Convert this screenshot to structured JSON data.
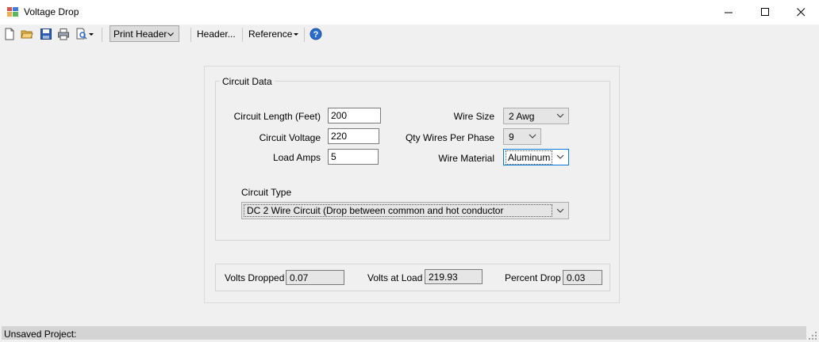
{
  "window": {
    "title": "Voltage Drop",
    "minimize_glyph": "—",
    "maximize_glyph": "☐",
    "close_glyph": "✕"
  },
  "toolbar": {
    "icons": [
      "new-document-icon",
      "open-folder-icon",
      "save-icon",
      "print-icon",
      "print-preview-icon"
    ],
    "print_header_label": "Print Header",
    "header_label": "Header...",
    "reference_label": "Reference",
    "help_icon": "help-icon"
  },
  "circuit_data": {
    "group_title": "Circuit Data",
    "circuit_length_label": "Circuit Length (Feet)",
    "circuit_length_value": "200",
    "circuit_voltage_label": "Circuit Voltage",
    "circuit_voltage_value": "220",
    "load_amps_label": "Load Amps",
    "load_amps_value": "5",
    "wire_size_label": "Wire Size",
    "wire_size_value": "2 Awg",
    "qty_wires_label": "Qty Wires Per Phase",
    "qty_wires_value": "9",
    "wire_material_label": "Wire Material",
    "wire_material_value": "Aluminum",
    "circuit_type_label": "Circuit Type",
    "circuit_type_value": "DC 2 Wire Circuit (Drop between common and hot conductor"
  },
  "results": {
    "volts_dropped_label": "Volts Dropped",
    "volts_dropped_value": "0.07",
    "volts_at_load_label": "Volts at Load",
    "volts_at_load_value": "219.93",
    "percent_drop_label": "Percent Drop",
    "percent_drop_value": "0.03"
  },
  "status": {
    "text": "Unsaved Project:"
  },
  "colors": {
    "focus_border": "#0078d7",
    "help_blue": "#2a6ccc"
  }
}
